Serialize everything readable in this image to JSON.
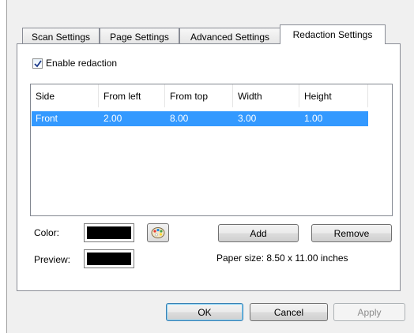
{
  "tabs": [
    {
      "label": "Scan Settings",
      "active": false
    },
    {
      "label": "Page Settings",
      "active": false
    },
    {
      "label": "Advanced Settings",
      "active": false
    },
    {
      "label": "Redaction Settings",
      "active": true
    }
  ],
  "enable_redaction": {
    "label": "Enable redaction",
    "checked": true
  },
  "table": {
    "columns": [
      "Side",
      "From left",
      "From top",
      "Width",
      "Height"
    ],
    "rows": [
      {
        "side": "Front",
        "from_left": "2.00",
        "from_top": "8.00",
        "width": "3.00",
        "height": "1.00",
        "selected": true
      }
    ]
  },
  "color": {
    "label": "Color:",
    "value": "#000000"
  },
  "preview": {
    "label": "Preview:",
    "value": "#000000"
  },
  "buttons": {
    "add": "Add",
    "remove": "Remove",
    "ok": "OK",
    "cancel": "Cancel",
    "apply": "Apply"
  },
  "paper_size": "Paper size:  8.50 x 11.00 inches",
  "icons": {
    "checkbox": "checkmark-icon",
    "palette": "palette-icon"
  },
  "colors": {
    "selection": "#3399ff",
    "dialog": "#f0f0f0"
  }
}
